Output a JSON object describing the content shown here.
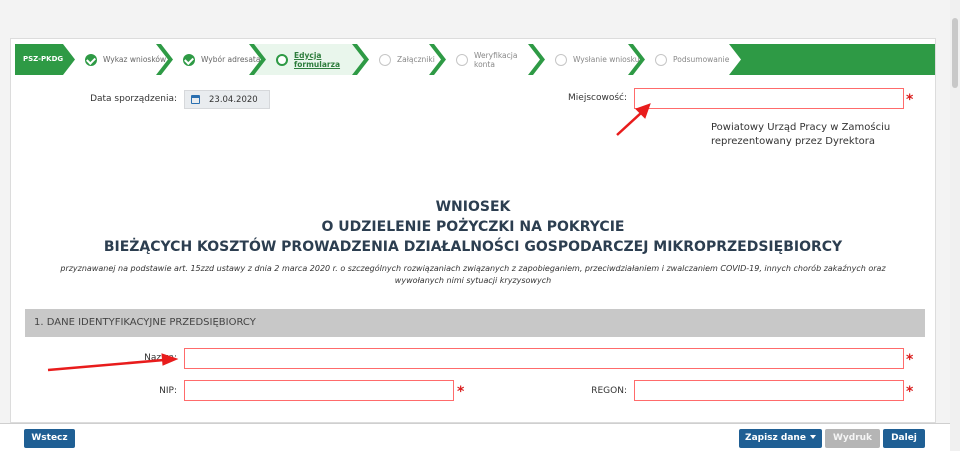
{
  "stepper": {
    "code": "PSZ-PKDG",
    "steps": [
      {
        "label": "Wykaz wniosków",
        "state": "done"
      },
      {
        "label": "Wybór adresata",
        "state": "done"
      },
      {
        "label": "Edycja formularza",
        "state": "active"
      },
      {
        "label": "Załączniki",
        "state": "todo"
      },
      {
        "label": "Weryfikacja konta",
        "state": "todo"
      },
      {
        "label": "Wysłanie wniosku",
        "state": "todo"
      },
      {
        "label": "Podsumowanie",
        "state": "todo"
      }
    ]
  },
  "form": {
    "date_label": "Data sporządzenia:",
    "date_value": "23.04.2020",
    "city_label": "Miejscowość:",
    "city_value": "",
    "office_line1": "Powiatowy Urząd Pracy w Zamościu",
    "office_line2": "reprezentowany przez Dyrektora",
    "required_mark": "*"
  },
  "document": {
    "title_line1": "WNIOSEK",
    "title_line2": "O UDZIELENIE POŻYCZKI NA POKRYCIE",
    "title_line3": "BIEŻĄCYCH KOSZTÓW PROWADZENIA DZIAŁALNOŚCI GOSPODARCZEJ MIKROPRZEDSIĘBIORCY",
    "subtitle": "przyznawanej na podstawie art. 15zzd ustawy z dnia 2 marca 2020 r. o szczególnych rozwiązaniach związanych z zapobieganiem, przeciwdziałaniem i zwalczaniem COVID-19, innych chorób zakaźnych oraz wywołanych nimi sytuacji kryzysowych"
  },
  "section1": {
    "title": "1. DANE IDENTYFIKACYJNE PRZEDSIĘBIORCY",
    "name_label": "Nazwa:",
    "nip_label": "NIP:",
    "regon_label": "REGON:"
  },
  "footer": {
    "back": "Wstecz",
    "save": "Zapisz dane",
    "print": "Wydruk",
    "next": "Dalej"
  },
  "colors": {
    "stepper_green": "#2e9a45",
    "required_red": "#d91b1b",
    "button_blue": "#1f5f94",
    "arrow_red": "#e81c1c"
  }
}
